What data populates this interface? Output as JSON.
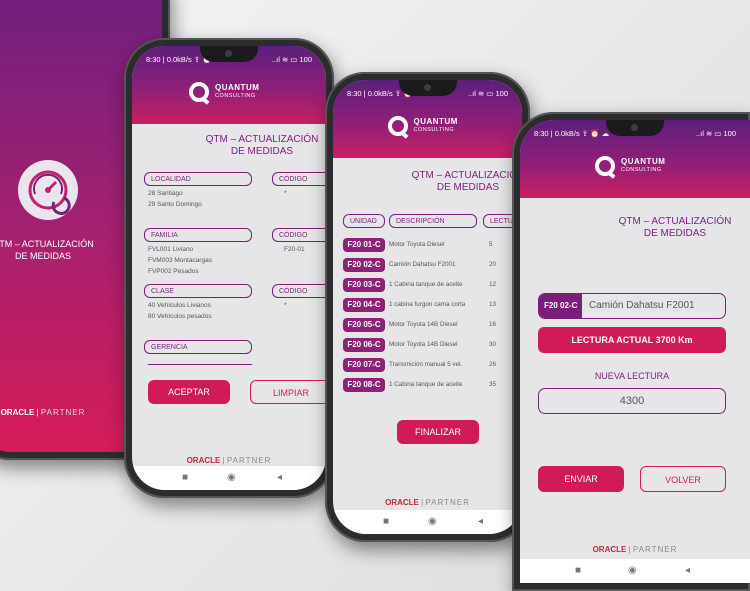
{
  "status_bar": {
    "left": "8:30 | 0.0kB/s ⇪ ⏰ ☁",
    "right": "..ıl ≋ ▭ 100"
  },
  "logo": {
    "line1": "QUANTUM",
    "line2": "CONSULTING"
  },
  "title": "QTM – ACTUALIZACIÓN DE MEDIDAS",
  "title_short": "QTM – ACTUALIZACIÓN\nDE MEDIDAS",
  "footer": {
    "brand": "ORACLE",
    "partner": "PARTNER"
  },
  "navbar": {
    "square": "■",
    "circle": "◉",
    "back": "◂"
  },
  "screen1": {
    "title_line1": "QTM – ACTUALIZACIÓN",
    "title_line2": "DE MEDIDAS",
    "footer_brand": "ORACLE",
    "footer_partner": "PARTNER"
  },
  "screen2": {
    "title_line1": "QTM – ACTUALIZACIÓN",
    "title_line2": "DE MEDIDAS",
    "localidad": {
      "label": "LOCALIDAD",
      "code_label": "CÓDIGO",
      "items": [
        "28 Santiago",
        "29 Santo Domingo"
      ],
      "code_value": "*"
    },
    "familia": {
      "label": "FAMILIA",
      "code_label": "CÓDIGO",
      "items": [
        "FVL001  Liviano",
        "FVM003 Montacargas",
        "FVP002  Pesados"
      ],
      "code_value": "F20-01"
    },
    "clase": {
      "label": "CLASE",
      "code_label": "CÓDIGO",
      "items": [
        "40 Vehículos Livianos",
        "80 Vehículos pesados"
      ],
      "code_value": "*"
    },
    "gerencia": {
      "label": "GERENCIA"
    },
    "accept_label": "ACEPTAR",
    "clear_label": "LIMPIAR"
  },
  "screen3": {
    "title_line1": "QTM – ACTUALIZACIÓN",
    "title_line2": "DE MEDIDAS",
    "columns": [
      "UNIDAD",
      "DESCRIPCIÓN",
      "LECTURA"
    ],
    "rows": [
      {
        "unit": "F20 01-C",
        "desc": "Motor Toyota Diesel",
        "num": "5"
      },
      {
        "unit": "F20 02-C",
        "desc": "Camión Dahatsu F2001",
        "num": "20"
      },
      {
        "unit": "F20 03-C",
        "desc": "1 Cabina tanque de aceite",
        "num": "12"
      },
      {
        "unit": "F20 04-C",
        "desc": "1 cabina furgon cama corta",
        "num": "13"
      },
      {
        "unit": "F20 05-C",
        "desc": "Motor Toyota 14B Diesel",
        "num": "16"
      },
      {
        "unit": "F20 06-C",
        "desc": "Motor Toyota 14B Diesel",
        "num": "30"
      },
      {
        "unit": "F20 07-C",
        "desc": "Transmición manual 5 vel.",
        "num": "26"
      },
      {
        "unit": "F20 08-C",
        "desc": "1 Cabina tanque de aceite",
        "num": "35"
      }
    ],
    "finish_label": "FINALIZAR"
  },
  "screen4": {
    "title_line1": "QTM – ACTUALIZACIÓN",
    "title_line2": "DE MEDIDAS",
    "unit_code": "F20 02-C",
    "unit_name": "Camión Dahatsu F2001",
    "current_reading": "LECTURA ACTUAL 3700 Km",
    "new_reading_label": "NUEVA LECTURA",
    "new_reading_value": "4300",
    "send_label": "ENVIAR",
    "back_label": "VOLVER"
  },
  "colors": {
    "primary": "#d11b58",
    "purple": "#7b1e7a",
    "gradient_top": "#5c1f7c"
  }
}
